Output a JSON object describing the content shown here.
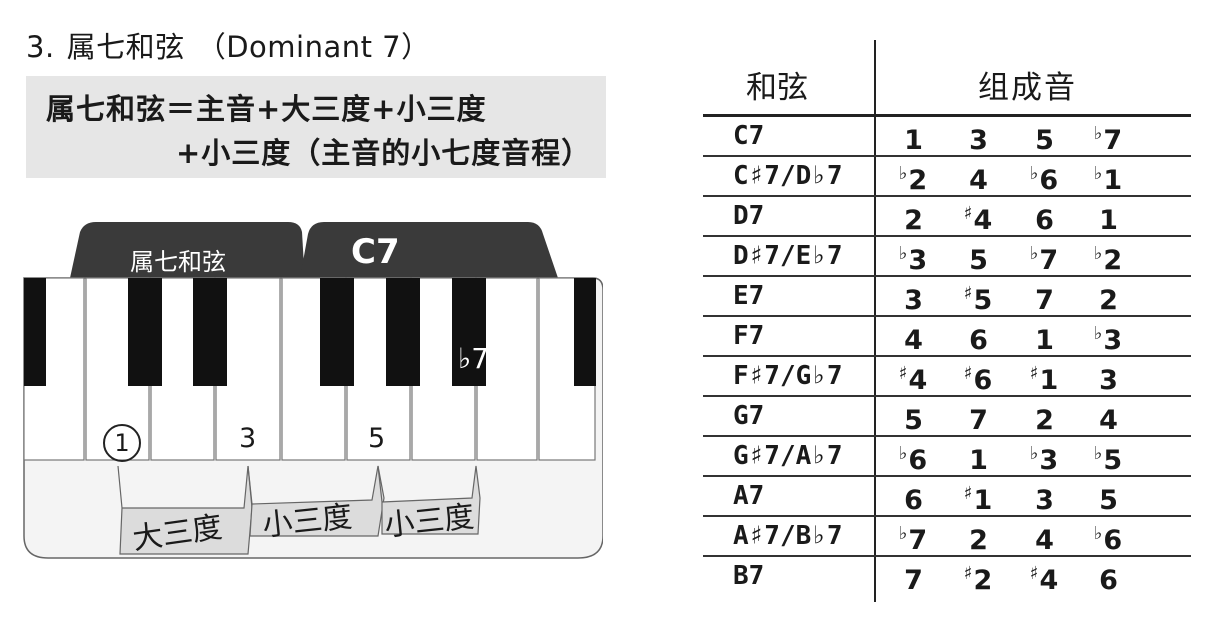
{
  "heading": {
    "number": "3.",
    "title": "属七和弦",
    "subtitle": "（Dominant 7）"
  },
  "formula": {
    "line1": "属七和弦＝主音+大三度+小三度",
    "line2": "+小三度（主音的小七度音程）"
  },
  "keyboard": {
    "tab1": "属七和弦",
    "tab2": "C7",
    "note_root": "1",
    "note_third": "3",
    "note_fifth": "5",
    "note_seventh": "♭7",
    "intervals": [
      "大三度",
      "小三度",
      "小三度"
    ]
  },
  "table": {
    "header_chord": "和弦",
    "header_notes": "组成音",
    "rows": [
      {
        "chord": "C7",
        "notes": [
          [
            "",
            "1"
          ],
          [
            "",
            "3"
          ],
          [
            "",
            "5"
          ],
          [
            "♭",
            "7"
          ]
        ]
      },
      {
        "chord": "C♯7/D♭7",
        "notes": [
          [
            "♭",
            "2"
          ],
          [
            "",
            "4"
          ],
          [
            "♭",
            "6"
          ],
          [
            "♭",
            "1"
          ]
        ]
      },
      {
        "chord": "D7",
        "notes": [
          [
            "",
            "2"
          ],
          [
            "♯",
            "4"
          ],
          [
            "",
            "6"
          ],
          [
            "",
            "1"
          ]
        ]
      },
      {
        "chord": "D♯7/E♭7",
        "notes": [
          [
            "♭",
            "3"
          ],
          [
            "",
            "5"
          ],
          [
            "♭",
            "7"
          ],
          [
            "♭",
            "2"
          ]
        ]
      },
      {
        "chord": "E7",
        "notes": [
          [
            "",
            "3"
          ],
          [
            "♯",
            "5"
          ],
          [
            "",
            "7"
          ],
          [
            "",
            "2"
          ]
        ]
      },
      {
        "chord": "F7",
        "notes": [
          [
            "",
            "4"
          ],
          [
            "",
            "6"
          ],
          [
            "",
            "1"
          ],
          [
            "♭",
            "3"
          ]
        ]
      },
      {
        "chord": "F♯7/G♭7",
        "notes": [
          [
            "♯",
            "4"
          ],
          [
            "♯",
            "6"
          ],
          [
            "♯",
            "1"
          ],
          [
            "",
            "3"
          ]
        ]
      },
      {
        "chord": "G7",
        "notes": [
          [
            "",
            "5"
          ],
          [
            "",
            "7"
          ],
          [
            "",
            "2"
          ],
          [
            "",
            "4"
          ]
        ]
      },
      {
        "chord": "G♯7/A♭7",
        "notes": [
          [
            "♭",
            "6"
          ],
          [
            "",
            "1"
          ],
          [
            "♭",
            "3"
          ],
          [
            "♭",
            "5"
          ]
        ]
      },
      {
        "chord": "A7",
        "notes": [
          [
            "",
            "6"
          ],
          [
            "♯",
            "1"
          ],
          [
            "",
            "3"
          ],
          [
            "",
            "5"
          ]
        ]
      },
      {
        "chord": "A♯7/B♭7",
        "notes": [
          [
            "♭",
            "7"
          ],
          [
            "",
            "2"
          ],
          [
            "",
            "4"
          ],
          [
            "♭",
            "6"
          ]
        ]
      },
      {
        "chord": "B7",
        "notes": [
          [
            "",
            "7"
          ],
          [
            "♯",
            "2"
          ],
          [
            "♯",
            "4"
          ],
          [
            "",
            "6"
          ]
        ]
      }
    ]
  }
}
